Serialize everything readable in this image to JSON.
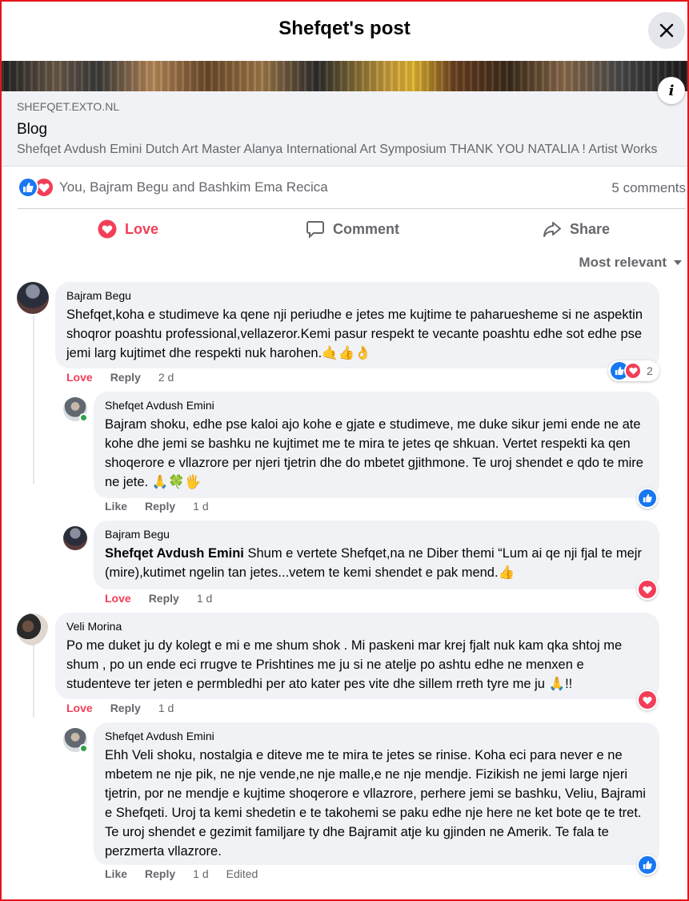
{
  "header": {
    "title": "Shefqet's post"
  },
  "link_preview": {
    "domain": "SHEFQET.EXTO.NL",
    "title": "Blog",
    "description": "Shefqet Avdush Emini Dutch Art Master  Alanya International Art Symposium THANK YOU NATALIA ! Artist Works"
  },
  "reactions": {
    "names": "You, Bajram Begu and Bashkim Ema Recica",
    "comment_count": "5 comments"
  },
  "actions": {
    "love": "Love",
    "comment": "Comment",
    "share": "Share"
  },
  "sort": {
    "label": "Most relevant"
  },
  "comments": [
    {
      "author": "Bajram Begu",
      "text": "Shefqet,koha e studimeve ka qene nji periudhe e jetes me kujtime te paharuesheme si ne aspektin shoqror poashtu professional,vellazeror.Kemi pasur respekt te vecante poashtu edhe sot edhe pse jemi larg kujtimet dhe respekti nuk harohen.🤙👍👌",
      "react_label": "Love",
      "reply_label": "Reply",
      "time": "2 d",
      "reaction_count": "2"
    },
    {
      "author": "Shefqet Avdush Emini",
      "text": "Bajram shoku, edhe pse kaloi ajo kohe e gjate e studimeve, me duke sikur jemi ende ne ate kohe dhe jemi se bashku ne kujtimet me te mira te jetes qe shkuan. Vertet respekti ka qen shoqerore e vllazrore per njeri tjetrin dhe do mbetet gjithmone. Te uroj shendet e qdo te mire ne jete. 🙏🍀🖐",
      "react_label": "Like",
      "reply_label": "Reply",
      "time": "1 d"
    },
    {
      "author": "Bajram Begu",
      "tag": "Shefqet Avdush Emini",
      "text": " Shum e vertete Shefqet,na ne Diber themi “Lum ai qe nji fjal te mejr (mire),kutimet ngelin tan jetes...vetem te kemi shendet e pak mend.👍",
      "react_label": "Love",
      "reply_label": "Reply",
      "time": "1 d"
    },
    {
      "author": "Veli Morina",
      "text": "Po me duket ju dy kolegt e mi e me shum shok . Mi paskeni mar krej fjalt nuk kam qka shtoj me shum , po un ende eci rrugve te Prishtines me ju si ne atelje po ashtu edhe ne menxen e studenteve ter jeten e permbledhi per ato kater pes vite dhe sillem rreth tyre me ju 🙏!!",
      "react_label": "Love",
      "reply_label": "Reply",
      "time": "1 d"
    },
    {
      "author": "Shefqet Avdush Emini",
      "text": "Ehh Veli shoku, nostalgia e diteve me te mira te jetes se rinise. Koha eci para never e ne mbetem ne nje pik, ne nje vende,ne nje malle,e ne nje mendje. Fizikish ne jemi large njeri tjetrin, por ne mendje e kujtime shoqerore e vllazrore, perhere jemi se bashku, Veliu, Bajrami e Shefqeti. Uroj ta kemi shedetin e te takohemi se paku edhe nje here ne ket bote qe te tret. Te uroj shendet e gezimit familjare ty dhe Bajramit atje ku gjinden ne Amerik. Te fala te perzmerta vllazrore.",
      "react_label": "Like",
      "reply_label": "Reply",
      "time": "1 d",
      "edited": "Edited"
    }
  ]
}
